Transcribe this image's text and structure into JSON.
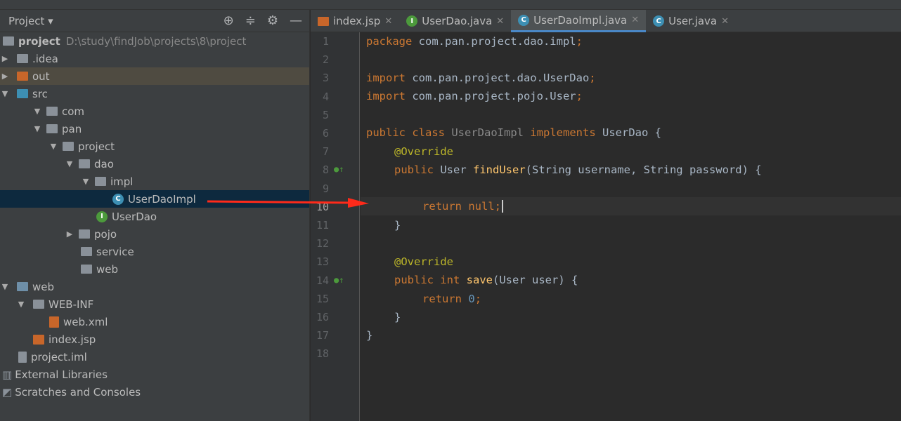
{
  "sidebar": {
    "title": "Project",
    "root": {
      "name": "project",
      "path": "D:\\study\\findJob\\projects\\8\\project"
    },
    "items": [
      ".idea",
      "out",
      "src",
      "com",
      "pan",
      "project",
      "dao",
      "impl",
      "UserDaoImpl",
      "UserDao",
      "pojo",
      "service",
      "web",
      "web",
      "WEB-INF",
      "web.xml",
      "index.jsp",
      "project.iml",
      "External Libraries",
      "Scratches and Consoles"
    ]
  },
  "tabs": [
    {
      "label": "index.jsp"
    },
    {
      "label": "UserDao.java"
    },
    {
      "label": "UserDaoImpl.java"
    },
    {
      "label": "User.java"
    }
  ],
  "code": {
    "lines": [
      "1",
      "2",
      "3",
      "4",
      "5",
      "6",
      "7",
      "8",
      "9",
      "10",
      "11",
      "12",
      "13",
      "14",
      "15",
      "16",
      "17",
      "18"
    ],
    "pkg": "package",
    "pkgname": " com.pan.project.dao.impl",
    "imp": "import",
    "imp1": " com.pan.project.dao.UserDao",
    "imp2": " com.pan.project.pojo.User",
    "semi": ";",
    "public": "public",
    "class": " class",
    "classname": " UserDaoImpl ",
    "implements": "implements",
    "iface": " UserDao {",
    "override": "@Override",
    "user": " User ",
    "finduser": "findUser",
    "params1": "(String username, String password) {",
    "return": "return",
    "null": " null;",
    "close": "}",
    "int": " int ",
    "save": "save",
    "params2": "(User user) {",
    "zero": "0"
  },
  "colors": {
    "keyword": "#cc7832",
    "method": "#ffc66d",
    "annotation": "#bbb529",
    "number": "#6897bb",
    "accent": "#4a88c7"
  }
}
